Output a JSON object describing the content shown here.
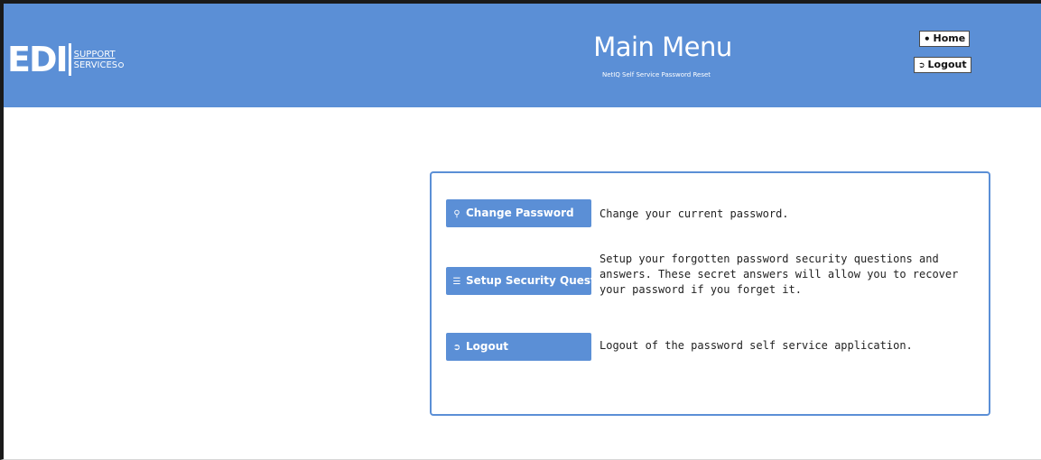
{
  "header": {
    "logo_main": "EDI",
    "logo_line1": "SUPPORT",
    "logo_line2": "SERVICES",
    "title": "Main Menu",
    "subtitle": "NetIQ Self Service Password Reset",
    "home_label": "Home",
    "home_icon": "house-icon",
    "logout_label": "Logout",
    "logout_icon": "logout-arrow-icon"
  },
  "menu": {
    "items": [
      {
        "label": "Change Password",
        "icon": "key-icon",
        "description": "Change your current password."
      },
      {
        "label": "Setup Security Questions",
        "icon": "list-icon",
        "description": "Setup your forgotten password security questions and answers. These secret answers will allow you to recover your password if you forget it."
      },
      {
        "label": "Logout",
        "icon": "logout-arrow-icon",
        "description": "Logout of the password self service application."
      }
    ]
  },
  "colors": {
    "header_bg": "#5b8fd6",
    "button_bg": "#5b8fd6",
    "panel_border": "#5b8fd6"
  }
}
